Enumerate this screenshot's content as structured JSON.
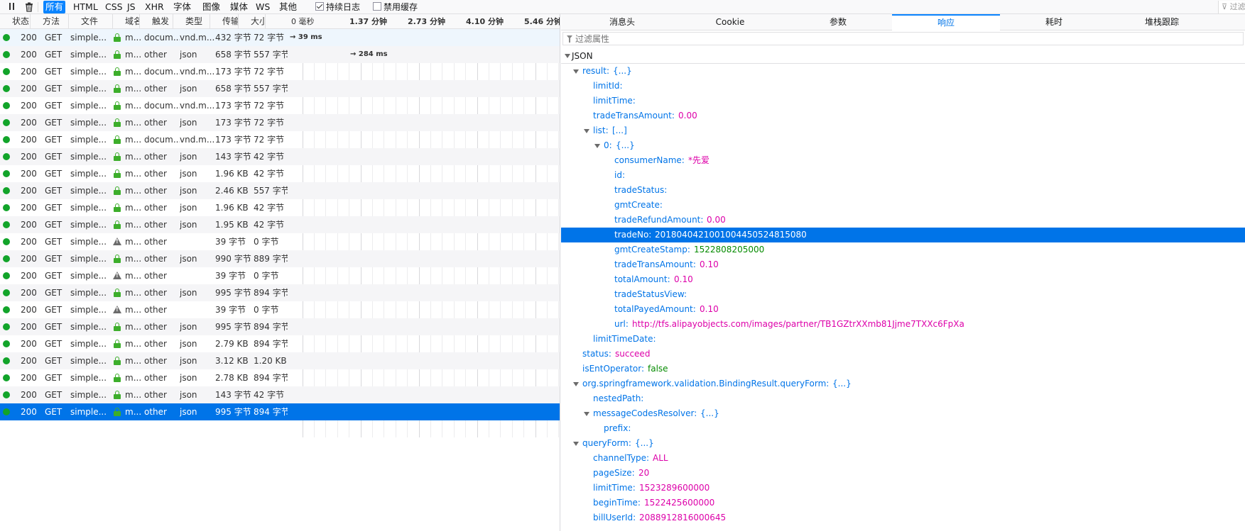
{
  "toolbar": {
    "filters": [
      "所有",
      "HTML",
      "CSS",
      "JS",
      "XHR",
      "字体",
      "图像",
      "媒体",
      "WS",
      "其他"
    ],
    "persist_logs": "持续日志",
    "disable_cache": "禁用缓存",
    "filter_url_placeholder": "过滤"
  },
  "list": {
    "columns": [
      "状态",
      "方法",
      "文件",
      "域名",
      "触发",
      "类型",
      "传输",
      "大小"
    ],
    "waterfall_ticks": [
      "0 毫秒",
      "1.37 分钟",
      "2.73 分钟",
      "4.10 分钟",
      "5.46 分钟"
    ],
    "rows": [
      {
        "status": "200",
        "method": "GET",
        "file": "simple...",
        "domain": "m...",
        "cause": "docum...",
        "type": "vnd.m...",
        "transferred": "432 字节",
        "size": "72 字节",
        "icon": "lock",
        "timing": "→ 39 ms"
      },
      {
        "status": "200",
        "method": "GET",
        "file": "simple...",
        "domain": "m...",
        "cause": "other",
        "type": "json",
        "transferred": "658 字节",
        "size": "557 字节",
        "icon": "lock",
        "timing": "→ 284 ms"
      },
      {
        "status": "200",
        "method": "GET",
        "file": "simple...",
        "domain": "m...",
        "cause": "docum...",
        "type": "vnd.m...",
        "transferred": "173 字节",
        "size": "72 字节",
        "icon": "lock",
        "timing": ""
      },
      {
        "status": "200",
        "method": "GET",
        "file": "simple...",
        "domain": "m...",
        "cause": "other",
        "type": "json",
        "transferred": "658 字节",
        "size": "557 字节",
        "icon": "lock",
        "timing": ""
      },
      {
        "status": "200",
        "method": "GET",
        "file": "simple...",
        "domain": "m...",
        "cause": "docum...",
        "type": "vnd.m...",
        "transferred": "173 字节",
        "size": "72 字节",
        "icon": "lock",
        "timing": ""
      },
      {
        "status": "200",
        "method": "GET",
        "file": "simple...",
        "domain": "m...",
        "cause": "other",
        "type": "json",
        "transferred": "173 字节",
        "size": "72 字节",
        "icon": "lock",
        "timing": ""
      },
      {
        "status": "200",
        "method": "GET",
        "file": "simple...",
        "domain": "m...",
        "cause": "docum...",
        "type": "vnd.m...",
        "transferred": "173 字节",
        "size": "72 字节",
        "icon": "lock",
        "timing": ""
      },
      {
        "status": "200",
        "method": "GET",
        "file": "simple...",
        "domain": "m...",
        "cause": "other",
        "type": "json",
        "transferred": "143 字节",
        "size": "42 字节",
        "icon": "lock",
        "timing": ""
      },
      {
        "status": "200",
        "method": "GET",
        "file": "simple...",
        "domain": "m...",
        "cause": "other",
        "type": "json",
        "transferred": "1.96 KB",
        "size": "42 字节",
        "icon": "lock",
        "timing": ""
      },
      {
        "status": "200",
        "method": "GET",
        "file": "simple...",
        "domain": "m...",
        "cause": "other",
        "type": "json",
        "transferred": "2.46 KB",
        "size": "557 字节",
        "icon": "lock",
        "timing": ""
      },
      {
        "status": "200",
        "method": "GET",
        "file": "simple...",
        "domain": "m...",
        "cause": "other",
        "type": "json",
        "transferred": "1.96 KB",
        "size": "42 字节",
        "icon": "lock",
        "timing": ""
      },
      {
        "status": "200",
        "method": "GET",
        "file": "simple...",
        "domain": "m...",
        "cause": "other",
        "type": "json",
        "transferred": "1.95 KB",
        "size": "42 字节",
        "icon": "lock",
        "timing": ""
      },
      {
        "status": "200",
        "method": "GET",
        "file": "simple...",
        "domain": "m...",
        "cause": "other",
        "type": "",
        "transferred": "39 字节",
        "size": "0 字节",
        "icon": "warning",
        "timing": ""
      },
      {
        "status": "200",
        "method": "GET",
        "file": "simple...",
        "domain": "m...",
        "cause": "other",
        "type": "json",
        "transferred": "990 字节",
        "size": "889 字节",
        "icon": "lock",
        "timing": ""
      },
      {
        "status": "200",
        "method": "GET",
        "file": "simple...",
        "domain": "m...",
        "cause": "other",
        "type": "",
        "transferred": "39 字节",
        "size": "0 字节",
        "icon": "warning",
        "timing": ""
      },
      {
        "status": "200",
        "method": "GET",
        "file": "simple...",
        "domain": "m...",
        "cause": "other",
        "type": "json",
        "transferred": "995 字节",
        "size": "894 字节",
        "icon": "lock",
        "timing": ""
      },
      {
        "status": "200",
        "method": "GET",
        "file": "simple...",
        "domain": "m...",
        "cause": "other",
        "type": "",
        "transferred": "39 字节",
        "size": "0 字节",
        "icon": "warning",
        "timing": ""
      },
      {
        "status": "200",
        "method": "GET",
        "file": "simple...",
        "domain": "m...",
        "cause": "other",
        "type": "json",
        "transferred": "995 字节",
        "size": "894 字节",
        "icon": "lock",
        "timing": ""
      },
      {
        "status": "200",
        "method": "GET",
        "file": "simple...",
        "domain": "m...",
        "cause": "other",
        "type": "json",
        "transferred": "2.79 KB",
        "size": "894 字节",
        "icon": "lock",
        "timing": ""
      },
      {
        "status": "200",
        "method": "GET",
        "file": "simple...",
        "domain": "m...",
        "cause": "other",
        "type": "json",
        "transferred": "3.12 KB",
        "size": "1.20 KB",
        "icon": "lock",
        "timing": ""
      },
      {
        "status": "200",
        "method": "GET",
        "file": "simple...",
        "domain": "m...",
        "cause": "other",
        "type": "json",
        "transferred": "2.78 KB",
        "size": "894 字节",
        "icon": "lock",
        "timing": ""
      },
      {
        "status": "200",
        "method": "GET",
        "file": "simple...",
        "domain": "m...",
        "cause": "other",
        "type": "json",
        "transferred": "143 字节",
        "size": "42 字节",
        "icon": "lock",
        "timing": ""
      },
      {
        "status": "200",
        "method": "GET",
        "file": "simple...",
        "domain": "m...",
        "cause": "other",
        "type": "json",
        "transferred": "995 字节",
        "size": "894 字节",
        "icon": "lock",
        "timing": "",
        "selected": true
      }
    ]
  },
  "details": {
    "tabs": [
      "消息头",
      "Cookie",
      "参数",
      "响应",
      "耗时",
      "堆栈跟踪"
    ],
    "active_tab": "响应",
    "filter_placeholder": "过滤属性",
    "json_label": "JSON",
    "tree": [
      {
        "level": 1,
        "key": "result:",
        "value": "{...}",
        "kind": "obj",
        "expanded": true
      },
      {
        "level": 2,
        "key": "limitId:",
        "value": ""
      },
      {
        "level": 2,
        "key": "limitTime:",
        "value": ""
      },
      {
        "level": 2,
        "key": "tradeTransAmount:",
        "value": "0.00",
        "kind": "str"
      },
      {
        "level": 2,
        "key": "list:",
        "value": "[...]",
        "kind": "obj",
        "expanded": true
      },
      {
        "level": 3,
        "key": "0:",
        "value": "{...}",
        "kind": "obj",
        "expanded": true
      },
      {
        "level": 4,
        "key": "consumerName:",
        "value": "*先爱",
        "kind": "str"
      },
      {
        "level": 4,
        "key": "id:",
        "value": ""
      },
      {
        "level": 4,
        "key": "tradeStatus:",
        "value": ""
      },
      {
        "level": 4,
        "key": "gmtCreate:",
        "value": ""
      },
      {
        "level": 4,
        "key": "tradeRefundAmount:",
        "value": "0.00",
        "kind": "str"
      },
      {
        "level": 4,
        "key": "tradeNo:",
        "value": "2018040421001004450524815080",
        "kind": "str",
        "selected": true
      },
      {
        "level": 4,
        "key": "gmtCreateStamp:",
        "value": "1522808205000",
        "kind": "num"
      },
      {
        "level": 4,
        "key": "tradeTransAmount:",
        "value": "0.10",
        "kind": "str"
      },
      {
        "level": 4,
        "key": "totalAmount:",
        "value": "0.10",
        "kind": "str"
      },
      {
        "level": 4,
        "key": "tradeStatusView:",
        "value": ""
      },
      {
        "level": 4,
        "key": "totalPayedAmount:",
        "value": "0.10",
        "kind": "str"
      },
      {
        "level": 4,
        "key": "url:",
        "value": "http://tfs.alipayobjects.com/images/partner/TB1GZtrXXmb81Jjme7TXXc6FpXa",
        "kind": "str"
      },
      {
        "level": 2,
        "key": "limitTimeDate:",
        "value": ""
      },
      {
        "level": 1,
        "key": "status:",
        "value": "succeed",
        "kind": "str"
      },
      {
        "level": 1,
        "key": "isEntOperator:",
        "value": "false",
        "kind": "num"
      },
      {
        "level": 1,
        "key": "org.springframework.validation.BindingResult.queryForm:",
        "value": "{...}",
        "kind": "obj",
        "expanded": true
      },
      {
        "level": 2,
        "key": "nestedPath:",
        "value": ""
      },
      {
        "level": 2,
        "key": "messageCodesResolver:",
        "value": "{...}",
        "kind": "obj",
        "expanded": true
      },
      {
        "level": 3,
        "key": "prefix:",
        "value": ""
      },
      {
        "level": 1,
        "key": "queryForm:",
        "value": "{...}",
        "kind": "obj",
        "expanded": true
      },
      {
        "level": 2,
        "key": "channelType:",
        "value": "ALL",
        "kind": "str"
      },
      {
        "level": 2,
        "key": "pageSize:",
        "value": "20",
        "kind": "str"
      },
      {
        "level": 2,
        "key": "limitTime:",
        "value": "1523289600000",
        "kind": "str"
      },
      {
        "level": 2,
        "key": "beginTime:",
        "value": "1522425600000",
        "kind": "str"
      },
      {
        "level": 2,
        "key": "billUserId:",
        "value": "2088912816000645",
        "kind": "str"
      }
    ]
  },
  "colors": {
    "accent": "#0a84ff",
    "selection": "#0074e8",
    "status_ok": "#12a42a",
    "secure": "#3dae2b",
    "json_key": "#0074e8",
    "json_string": "#dd00a9",
    "json_literal": "#058b00"
  }
}
